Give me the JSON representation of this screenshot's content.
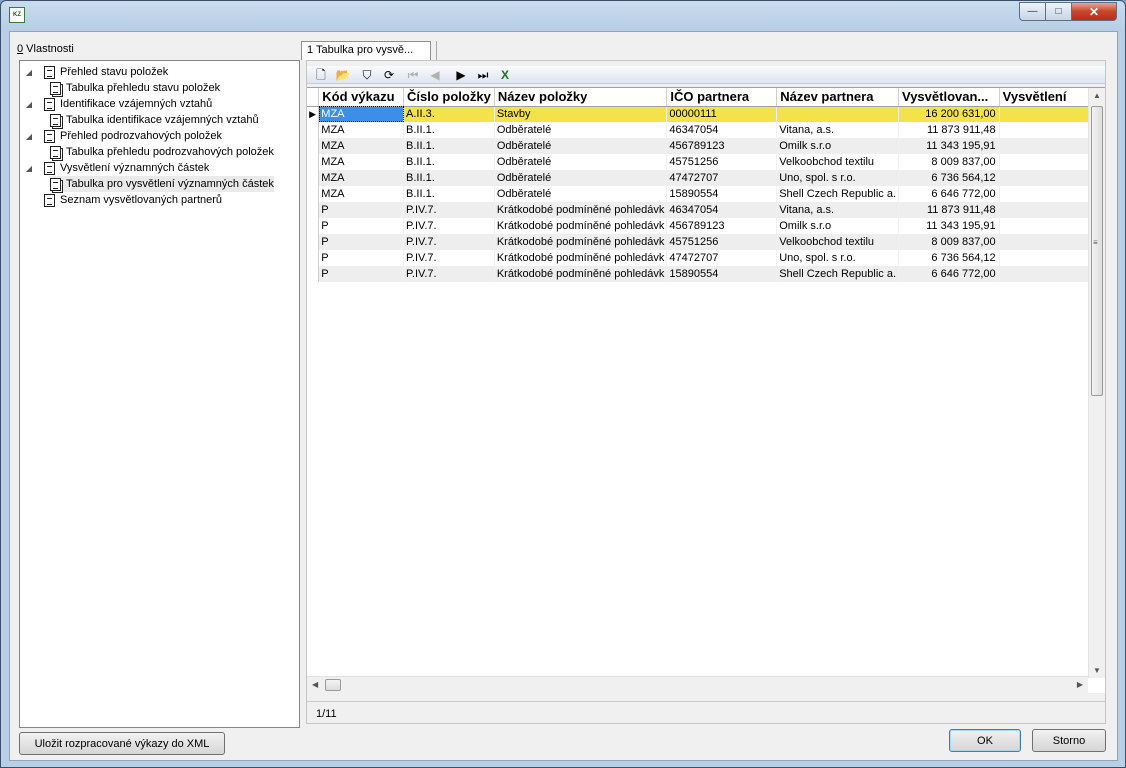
{
  "app_icon_text": "KZ",
  "window_buttons": {
    "minimize": "—",
    "maximize": "□",
    "close": "✕"
  },
  "left_panel": {
    "label_accel": "0",
    "label_rest": " Vlastnosti",
    "tree": [
      {
        "label": "Přehled stavu položek",
        "level": 0,
        "expander": "◢"
      },
      {
        "label": "Tabulka přehledu stavu položek",
        "level": 1
      },
      {
        "label": "Identifikace vzájemných vztahů",
        "level": 0,
        "expander": "◢"
      },
      {
        "label": "Tabulka identifikace vzájemných vztahů",
        "level": 1
      },
      {
        "label": "Přehled podrozvahových položek",
        "level": 0,
        "expander": "◢"
      },
      {
        "label": "Tabulka přehledu podrozvahových položek",
        "level": 1
      },
      {
        "label": "Vysvětlení významných částek",
        "level": 0,
        "expander": "◢"
      },
      {
        "label": "Tabulka pro vysvětlení významných částek",
        "level": 1,
        "selected": true
      },
      {
        "label": "Seznam vysvětlovaných partnerů",
        "level": 0
      }
    ]
  },
  "tab": {
    "label": "1 Tabulka pro vysvě..."
  },
  "toolbar": {
    "buttons": [
      {
        "name": "new-icon",
        "glyph": "🗋",
        "enabled": true
      },
      {
        "name": "open-folder-icon",
        "glyph": "📂",
        "enabled": true
      },
      {
        "name": "save-icon",
        "glyph": "⛉",
        "enabled": true
      },
      {
        "name": "refresh-icon",
        "glyph": "⟳",
        "enabled": true
      },
      {
        "name": "first-record-icon",
        "glyph": "⏮",
        "enabled": false
      },
      {
        "name": "previous-record-icon",
        "glyph": "◀",
        "enabled": false
      },
      {
        "name": "next-record-icon",
        "glyph": "▶",
        "enabled": true
      },
      {
        "name": "last-record-icon",
        "glyph": "⏭",
        "enabled": true
      },
      {
        "name": "excel-export-icon",
        "glyph": "X",
        "enabled": true
      }
    ]
  },
  "grid": {
    "columns": [
      "Kód výkazu",
      "Číslo položky",
      "Název položky",
      "IČO partnera",
      "Název partnera",
      "Vysvětlovan...",
      "Vysvětlení"
    ],
    "row_indicator": "▶",
    "rows": [
      [
        "MZA",
        "A.II.3.",
        "Stavby",
        "00000111",
        "",
        "16 200 631,00",
        ""
      ],
      [
        "MZA",
        "B.II.1.",
        "Odběratelé",
        "46347054",
        "Vitana, a.s.",
        "11 873 911,48",
        ""
      ],
      [
        "MZA",
        "B.II.1.",
        "Odběratelé",
        "456789123",
        "Omilk s.r.o",
        "11 343 195,91",
        ""
      ],
      [
        "MZA",
        "B.II.1.",
        "Odběratelé",
        "45751256",
        "Velkoobchod textilu",
        "8 009 837,00",
        ""
      ],
      [
        "MZA",
        "B.II.1.",
        "Odběratelé",
        "47472707",
        "Uno, spol. s r.o.",
        "6 736 564,12",
        ""
      ],
      [
        "MZA",
        "B.II.1.",
        "Odběratelé",
        "15890554",
        "Shell Czech Republic a.",
        "6 646 772,00",
        ""
      ],
      [
        "P",
        "P.IV.7.",
        "Krátkodobé podmíněné pohledávk",
        "46347054",
        "Vitana, a.s.",
        "11 873 911,48",
        ""
      ],
      [
        "P",
        "P.IV.7.",
        "Krátkodobé podmíněné pohledávk",
        "456789123",
        "Omilk s.r.o",
        "11 343 195,91",
        ""
      ],
      [
        "P",
        "P.IV.7.",
        "Krátkodobé podmíněné pohledávk",
        "45751256",
        "Velkoobchod textilu",
        "8 009 837,00",
        ""
      ],
      [
        "P",
        "P.IV.7.",
        "Krátkodobé podmíněné pohledávk",
        "47472707",
        "Uno, spol. s r.o.",
        "6 736 564,12",
        ""
      ],
      [
        "P",
        "P.IV.7.",
        "Krátkodobé podmíněné pohledávk",
        "15890554",
        "Shell Czech Republic a.",
        "6 646 772,00",
        ""
      ]
    ]
  },
  "status": {
    "record_position": "1/11"
  },
  "buttons": {
    "save_xml": "Uložit rozpracované výkazy do XML",
    "ok": "OK",
    "cancel": "Storno"
  },
  "colors": {
    "selected_row": "#f3e24a",
    "focus_cell": "#3b8fe6"
  }
}
